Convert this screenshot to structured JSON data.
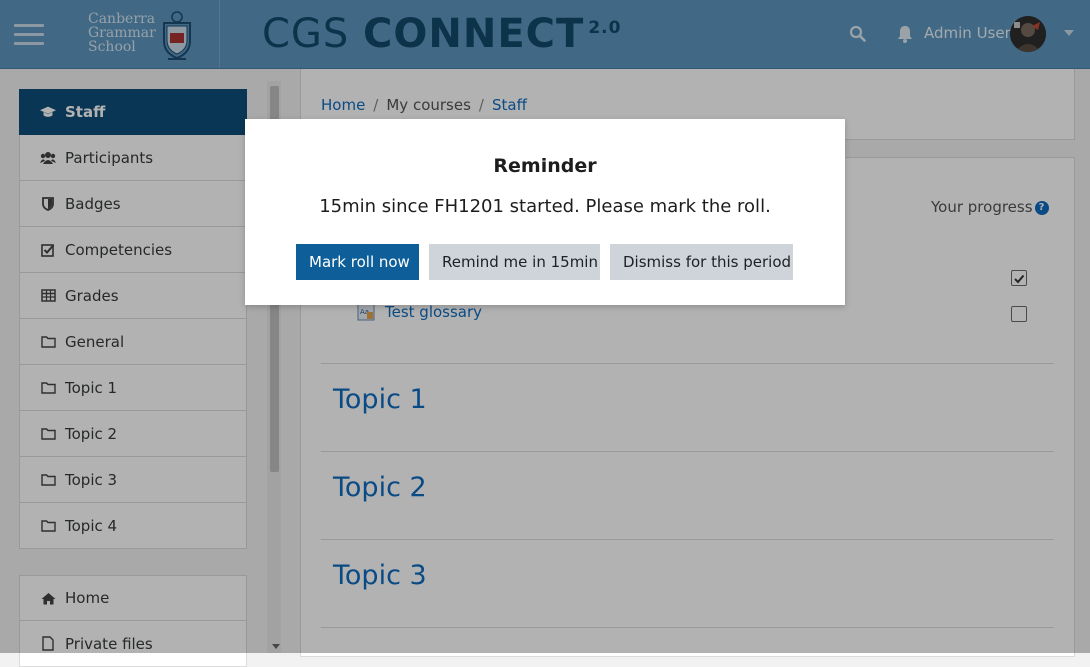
{
  "header": {
    "school_name": "Canberra\nGrammar\nSchool",
    "brand_light": "CGS ",
    "brand_bold": "CONNECT",
    "brand_version": "2.0",
    "user_name": "Admin User"
  },
  "sidebar": {
    "items": [
      {
        "label": "Staff",
        "icon": "graduation-cap-icon",
        "active": true
      },
      {
        "label": "Participants",
        "icon": "users-icon"
      },
      {
        "label": "Badges",
        "icon": "shield-icon"
      },
      {
        "label": "Competencies",
        "icon": "checkbox-icon"
      },
      {
        "label": "Grades",
        "icon": "table-icon"
      },
      {
        "label": "General",
        "icon": "folder-icon"
      },
      {
        "label": "Topic 1",
        "icon": "folder-icon"
      },
      {
        "label": "Topic 2",
        "icon": "folder-icon"
      },
      {
        "label": "Topic 3",
        "icon": "folder-icon"
      },
      {
        "label": "Topic 4",
        "icon": "folder-icon"
      }
    ],
    "items2": [
      {
        "label": "Home",
        "icon": "home-icon"
      },
      {
        "label": "Private files",
        "icon": "file-icon"
      }
    ]
  },
  "breadcrumb": [
    "Home",
    "My courses",
    "Staff"
  ],
  "course": {
    "progress_label": "Your progress",
    "activity_label": "Test glossary",
    "sections": [
      "Topic 1",
      "Topic 2",
      "Topic 3"
    ]
  },
  "modal": {
    "title": "Reminder",
    "message": "15min since FH1201 started. Please mark the roll.",
    "primary_label": "Mark roll now",
    "remind_label": "Remind me in 15min",
    "dismiss_label": "Dismiss for this period"
  },
  "colors": {
    "header_bg": "#5d96be",
    "brand": "#144a6c",
    "active_nav": "#0f4e7a",
    "link": "#0f6cbf",
    "primary_button": "#0e5f99"
  }
}
